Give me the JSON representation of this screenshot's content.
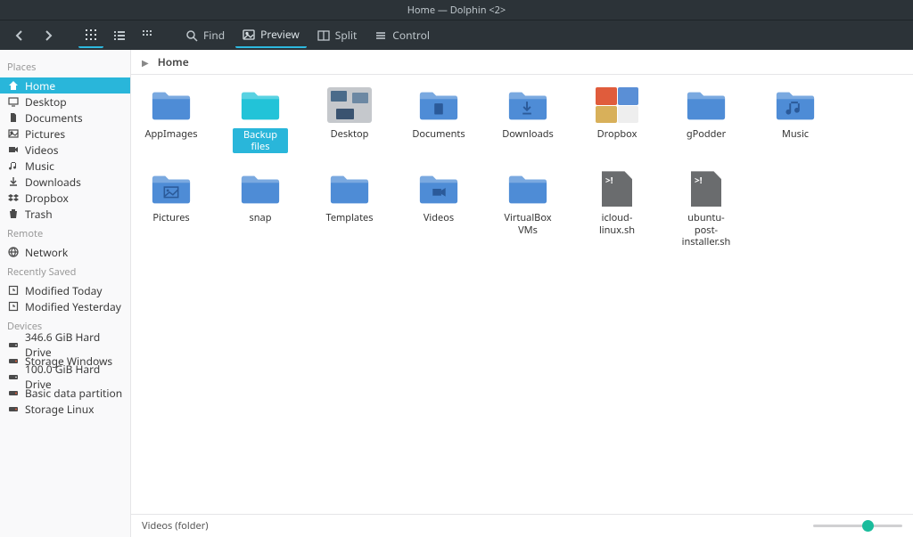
{
  "window": {
    "title": "Home — Dolphin <2>"
  },
  "toolbar": {
    "find_label": "Find",
    "preview_label": "Preview",
    "split_label": "Split",
    "control_label": "Control"
  },
  "sidebar": {
    "sections": {
      "places": {
        "title": "Places",
        "items": [
          {
            "label": "Home",
            "icon": "home",
            "selected": true
          },
          {
            "label": "Desktop",
            "icon": "desktop"
          },
          {
            "label": "Documents",
            "icon": "document"
          },
          {
            "label": "Pictures",
            "icon": "image"
          },
          {
            "label": "Videos",
            "icon": "video"
          },
          {
            "label": "Music",
            "icon": "music"
          },
          {
            "label": "Downloads",
            "icon": "download"
          },
          {
            "label": "Dropbox",
            "icon": "dropbox"
          },
          {
            "label": "Trash",
            "icon": "trash"
          }
        ]
      },
      "remote": {
        "title": "Remote",
        "items": [
          {
            "label": "Network",
            "icon": "network"
          }
        ]
      },
      "recent": {
        "title": "Recently Saved",
        "items": [
          {
            "label": "Modified Today",
            "icon": "clock"
          },
          {
            "label": "Modified Yesterday",
            "icon": "clock"
          }
        ]
      },
      "devices": {
        "title": "Devices",
        "items": [
          {
            "label": "346.6 GiB Hard Drive",
            "icon": "drive"
          },
          {
            "label": "Storage Windows",
            "icon": "drive-red"
          },
          {
            "label": "100.0 GiB Hard Drive",
            "icon": "drive"
          },
          {
            "label": "Basic data partition",
            "icon": "drive-red"
          },
          {
            "label": "Storage Linux",
            "icon": "drive-red"
          }
        ]
      }
    }
  },
  "breadcrumb": {
    "segments": [
      "Home"
    ]
  },
  "grid_items": [
    {
      "name": "AppImages",
      "type": "folder",
      "color": "#4e8cd6"
    },
    {
      "name": "Backup files",
      "type": "folder",
      "color": "#22c3d8",
      "selected": true
    },
    {
      "name": "Desktop",
      "type": "desktop-collage"
    },
    {
      "name": "Documents",
      "type": "folder",
      "color": "#4e8cd6",
      "glyph": "document"
    },
    {
      "name": "Downloads",
      "type": "folder",
      "color": "#4e8cd6",
      "glyph": "download"
    },
    {
      "name": "Dropbox",
      "type": "dropbox-collage"
    },
    {
      "name": "gPodder",
      "type": "folder",
      "color": "#4e8cd6"
    },
    {
      "name": "Music",
      "type": "folder",
      "color": "#4e8cd6",
      "glyph": "music"
    },
    {
      "name": "Pictures",
      "type": "folder",
      "color": "#4e8cd6",
      "glyph": "image"
    },
    {
      "name": "snap",
      "type": "folder",
      "color": "#4e8cd6"
    },
    {
      "name": "Templates",
      "type": "folder",
      "color": "#4e8cd6"
    },
    {
      "name": "Videos",
      "type": "folder",
      "color": "#4e8cd6",
      "glyph": "video"
    },
    {
      "name": "VirtualBox VMs",
      "type": "folder",
      "color": "#4e8cd6"
    },
    {
      "name": "icloud-linux.sh",
      "type": "script"
    },
    {
      "name": "ubuntu-post-installer.sh",
      "type": "script"
    }
  ],
  "status": {
    "text": "Videos (folder)",
    "zoom_percent": 55
  }
}
